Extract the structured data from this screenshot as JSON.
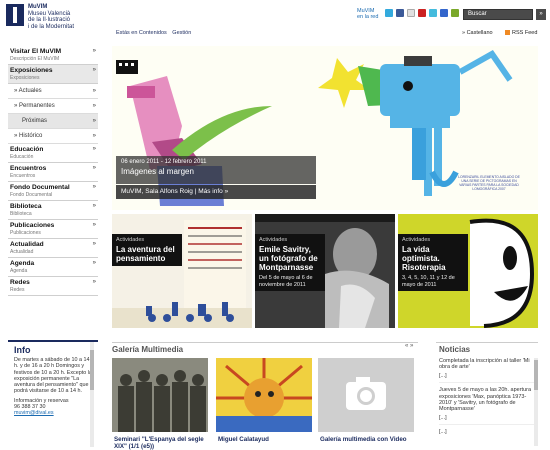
{
  "header": {
    "logo_title": "MuVIM",
    "logo_sub1": "Museu Valencià",
    "logo_sub2": "de la Il·lustració",
    "logo_sub3": "i de la Modernitat",
    "breadcrumb": [
      "Estás en Contenidos",
      "Gestión"
    ],
    "muvim_red_1": "MuVIM",
    "muvim_red_2": "en la red",
    "socials": [
      {
        "icon": "twitter-icon",
        "color": "#33aadd"
      },
      {
        "icon": "facebook-icon",
        "color": "#3b5998"
      },
      {
        "icon": "flickr-icon",
        "color": "#e0e0e0"
      },
      {
        "icon": "youtube-icon",
        "color": "#cc2222"
      },
      {
        "icon": "vimeo-icon",
        "color": "#44bbdd"
      },
      {
        "icon": "delicious-icon",
        "color": "#3366cc"
      },
      {
        "icon": "netvibes-icon",
        "color": "#7aa82a"
      }
    ],
    "search_value": "Buscar",
    "search_button": "»",
    "lang": "» Castellano",
    "rss": "RSS Feed"
  },
  "sidebar": {
    "items": [
      {
        "title": "Visitar El MuVIM",
        "sub": "Descripción El MuVIM"
      },
      {
        "title": "Exposiciones",
        "sub": "Exposiciones"
      }
    ],
    "subitems": [
      "» Actuales",
      "» Permanentes",
      "Próximas",
      "» Histórico"
    ],
    "items2": [
      {
        "title": "Educación",
        "sub": "Educación"
      },
      {
        "title": "Encuentros",
        "sub": "Encuentros"
      },
      {
        "title": "Fondo Documental",
        "sub": "Fondo Documental"
      },
      {
        "title": "Biblioteca",
        "sub": "Biblioteca"
      },
      {
        "title": "Publicaciones",
        "sub": "Publicaciones"
      },
      {
        "title": "Actualidad",
        "sub": "Actualidad"
      },
      {
        "title": "Agenda",
        "sub": "Agenda"
      },
      {
        "title": "Redes",
        "sub": "Redes"
      }
    ],
    "arrow": "»"
  },
  "info": {
    "title": "Info",
    "body": "De martes a sábado de 10 a 14 h. y de 16 a 20 h Domingos y festivos de 10 a 20 h. Excepto la exposición permanente \"La aventura del pensamiento\" que podrá visitarse de 10 a 14 h.",
    "contact_1": "Información y reservas",
    "contact_2": "96 388 37 30",
    "mail": "muvim@dival.es"
  },
  "hero": {
    "date": "06 enero 2011 - 12 febrero 2011",
    "title": "Imágenes al margen",
    "link": "MuVIM, Sala Alfons Roig | Más info »",
    "credit": "LORENZARIL ELEMENTO AISLADO DE UNA SERIE DE PICTOGRAMAS EN VARIAS PARTES PARA LA SOCIEDAD LOMOGRÁFICA 2007"
  },
  "cards": [
    {
      "tag": "Actividades",
      "title": "La aventura del pensamiento",
      "date": ""
    },
    {
      "tag": "Actividades",
      "title": "Emile Savitry, un fotógrafo de Montparnasse",
      "date": "Del 5 de mayo al 6 de noviembre de 2011"
    },
    {
      "tag": "Actividades",
      "title": "La vida optimista. Risoterapia",
      "date": "3, 4, 5, 10, 11 y 12 de mayo de 2011"
    }
  ],
  "gallery": {
    "title": "Galería Multimedia",
    "arrows": "« »",
    "captions": [
      "Seminari \"L'Espanya del segle XIX\" (1/1 (e5))",
      "Miguel Calatayud",
      "Galería multimedia con Video"
    ]
  },
  "news": {
    "title": "Noticias",
    "items": [
      {
        "text": "Completada la inscripción al taller 'Mi obra de arte'",
        "more": "[...]"
      },
      {
        "text": "Jueves 5 de mayo a las 20h. apertura exposiciones 'Max, panóptica 1973-2010' y 'Savitry, un fotógrafo de Montparnasse'",
        "more": "[...]"
      },
      {
        "text": "",
        "more": "[...]"
      }
    ]
  }
}
